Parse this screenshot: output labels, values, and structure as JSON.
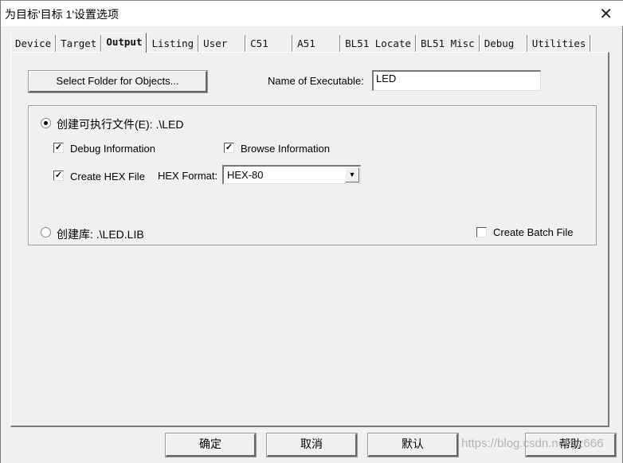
{
  "window": {
    "title": "为目标'目标 1'设置选项",
    "close_icon": "close-icon"
  },
  "tabs": [
    {
      "label": "Device",
      "active": false
    },
    {
      "label": "Target",
      "active": false
    },
    {
      "label": "Output",
      "active": true
    },
    {
      "label": "Listing",
      "active": false
    },
    {
      "label": "User",
      "active": false
    },
    {
      "label": "C51",
      "active": false
    },
    {
      "label": "A51",
      "active": false
    },
    {
      "label": "BL51 Locate",
      "active": false
    },
    {
      "label": "BL51 Misc",
      "active": false
    },
    {
      "label": "Debug",
      "active": false
    },
    {
      "label": "Utilities",
      "active": false
    }
  ],
  "output": {
    "select_folder_label": "Select Folder for Objects...",
    "name_of_executable_label": "Name of Executable:",
    "name_of_executable_value": "LED",
    "create_executable": {
      "label": "创建可执行文件(E):  .\\LED",
      "selected": true
    },
    "debug_information": {
      "label": "Debug Information",
      "checked": true
    },
    "browse_information": {
      "label": "Browse Information",
      "checked": true
    },
    "create_hex_file": {
      "label": "Create HEX File",
      "checked": true
    },
    "hex_format_label": "HEX Format:",
    "hex_format_value": "HEX-80",
    "create_library": {
      "label": "创建库:  .\\LED.LIB",
      "selected": false
    },
    "create_batch_file": {
      "label": "Create Batch File",
      "checked": false
    }
  },
  "footer": {
    "ok_label": "确定",
    "cancel_label": "取消",
    "defaults_label": "默认",
    "help_label": "帮助"
  },
  "watermark": "https://blog.csdn.net/yz666"
}
